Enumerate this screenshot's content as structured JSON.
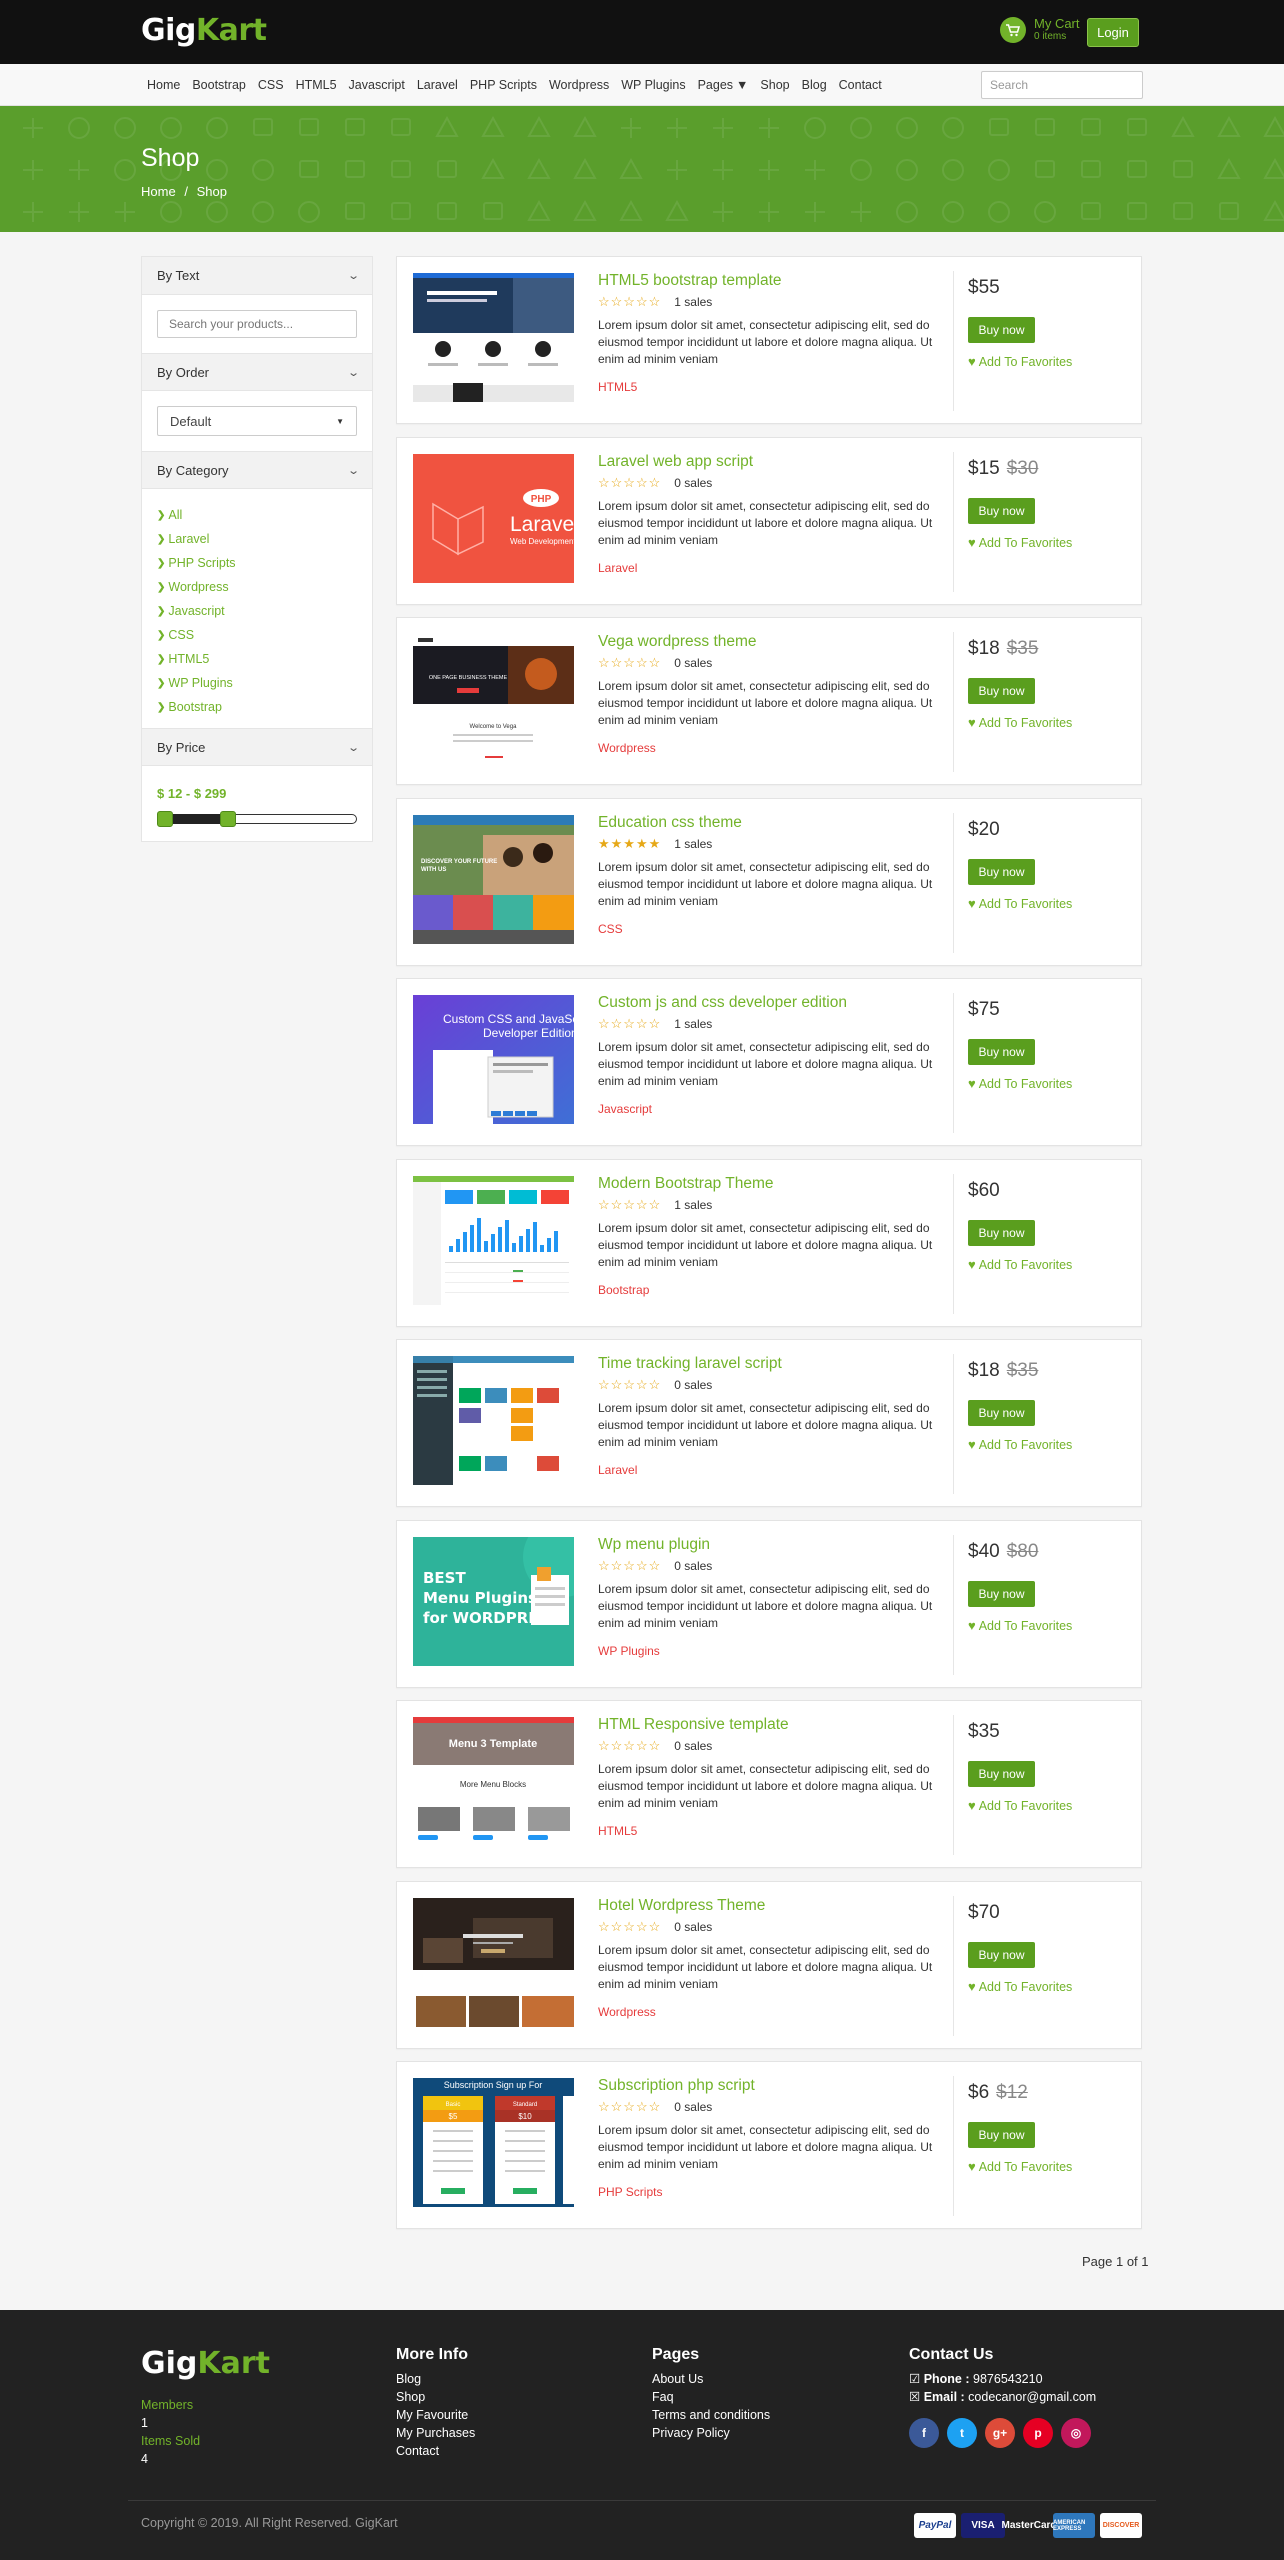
{
  "header": {
    "logo_a": "Gig",
    "logo_b": "Kart",
    "cart_label": "My Cart",
    "cart_count": "0 items",
    "login": "Login"
  },
  "nav": {
    "items": [
      "Home",
      "Bootstrap",
      "CSS",
      "HTML5",
      "Javascript",
      "Laravel",
      "PHP Scripts",
      "Wordpress",
      "WP Plugins",
      "Pages",
      "Shop",
      "Blog",
      "Contact"
    ],
    "search_placeholder": "Search"
  },
  "banner": {
    "title": "Shop",
    "crumb_home": "Home",
    "crumb_sep": "/",
    "crumb_current": "Shop"
  },
  "sidebar": {
    "by_text": "By Text",
    "search_placeholder": "Search your products...",
    "by_order": "By Order",
    "order_value": "Default",
    "by_category": "By Category",
    "categories": [
      "All",
      "Laravel",
      "PHP Scripts",
      "Wordpress",
      "Javascript",
      "CSS",
      "HTML5",
      "WP Plugins",
      "Bootstrap"
    ],
    "by_price": "By Price",
    "price_range": "$ 12 - $ 299",
    "slider_min_fraction": 0.0,
    "slider_max_fraction": 0.18
  },
  "products": [
    {
      "title": "HTML5 bootstrap template",
      "rating": 0,
      "sales": "1 sales",
      "desc": "Lorem ipsum dolor sit amet, consectetur adipiscing elit, sed do eiusmod tempor incididunt ut labore et dolore magna aliqua. Ut enim ad minim veniam",
      "category": "HTML5",
      "price": "$55",
      "old_price": "",
      "thumb": "html5"
    },
    {
      "title": "Laravel web app script",
      "rating": 0,
      "sales": "0 sales",
      "desc": "Lorem ipsum dolor sit amet, consectetur adipiscing elit, sed do eiusmod tempor incididunt ut labore et dolore magna aliqua. Ut enim ad minim veniam",
      "category": "Laravel",
      "price": "$15",
      "old_price": "$30",
      "thumb": "laravel",
      "thumb_text": "Laravel",
      "thumb_sub": "Web Development",
      "thumb_badge": "PHP"
    },
    {
      "title": "Vega wordpress theme",
      "rating": 0,
      "sales": "0 sales",
      "desc": "Lorem ipsum dolor sit amet, consectetur adipiscing elit, sed do eiusmod tempor incididunt ut labore et dolore magna aliqua. Ut enim ad minim veniam",
      "category": "Wordpress",
      "price": "$18",
      "old_price": "$35",
      "thumb": "vega",
      "thumb_text": "ONE PAGE BUSINESS THEME",
      "thumb_sub": "Welcome to Vega"
    },
    {
      "title": "Education css theme",
      "rating": 5,
      "sales": "1 sales",
      "desc": "Lorem ipsum dolor sit amet, consectetur adipiscing elit, sed do eiusmod tempor incididunt ut labore et dolore magna aliqua. Ut enim ad minim veniam",
      "category": "CSS",
      "price": "$20",
      "old_price": "",
      "thumb": "education",
      "thumb_text": "DISCOVER YOUR FUTURE WITH US"
    },
    {
      "title": "Custom js and css developer edition",
      "rating": 0,
      "sales": "1 sales",
      "desc": "Lorem ipsum dolor sit amet, consectetur adipiscing elit, sed do eiusmod tempor incididunt ut labore et dolore magna aliqua. Ut enim ad minim veniam",
      "category": "Javascript",
      "price": "$75",
      "old_price": "",
      "thumb": "customjs",
      "thumb_text": "Custom CSS and JavaSc",
      "thumb_sub": "Developer Edition"
    },
    {
      "title": "Modern Bootstrap Theme",
      "rating": 0,
      "sales": "1 sales",
      "desc": "Lorem ipsum dolor sit amet, consectetur adipiscing elit, sed do eiusmod tempor incididunt ut labore et dolore magna aliqua. Ut enim ad minim veniam",
      "category": "Bootstrap",
      "price": "$60",
      "old_price": "",
      "thumb": "dashboard"
    },
    {
      "title": "Time tracking laravel script",
      "rating": 0,
      "sales": "0 sales",
      "desc": "Lorem ipsum dolor sit amet, consectetur adipiscing elit, sed do eiusmod tempor incididunt ut labore et dolore magna aliqua. Ut enim ad minim veniam",
      "category": "Laravel",
      "price": "$18",
      "old_price": "$35",
      "thumb": "timetrack"
    },
    {
      "title": "Wp menu plugin",
      "rating": 0,
      "sales": "0 sales",
      "desc": "Lorem ipsum dolor sit amet, consectetur adipiscing elit, sed do eiusmod tempor incididunt ut labore et dolore magna aliqua. Ut enim ad minim veniam",
      "category": "WP Plugins",
      "price": "$40",
      "old_price": "$80",
      "thumb": "wpmenu",
      "thumb_text": "BEST",
      "thumb_sub": "Menu Plugins",
      "thumb_sub2": "for WORDPRESS"
    },
    {
      "title": "HTML Responsive template",
      "rating": 0,
      "sales": "0 sales",
      "desc": "Lorem ipsum dolor sit amet, consectetur adipiscing elit, sed do eiusmod tempor incididunt ut labore et dolore magna aliqua. Ut enim ad minim veniam",
      "category": "HTML5",
      "price": "$35",
      "old_price": "",
      "thumb": "menublocks",
      "thumb_text": "Menu 3 Template",
      "thumb_sub": "More Menu Blocks"
    },
    {
      "title": "Hotel Wordpress Theme",
      "rating": 0,
      "sales": "0 sales",
      "desc": "Lorem ipsum dolor sit amet, consectetur adipiscing elit, sed do eiusmod tempor incididunt ut labore et dolore magna aliqua. Ut enim ad minim veniam",
      "category": "Wordpress",
      "price": "$70",
      "old_price": "",
      "thumb": "hotel"
    },
    {
      "title": "Subscription php script",
      "rating": 0,
      "sales": "0 sales",
      "desc": "Lorem ipsum dolor sit amet, consectetur adipiscing elit, sed do eiusmod tempor incididunt ut labore et dolore magna aliqua. Ut enim ad minim veniam",
      "category": "PHP Scripts",
      "price": "$6",
      "old_price": "$12",
      "thumb": "subscription",
      "thumb_text": "Subscription Sign up For",
      "thumb_sub": "Basic",
      "thumb_sub2": "Standard",
      "thumb_p1": "$5",
      "thumb_p2": "$10"
    }
  ],
  "buy_label": "Buy now",
  "fav_label": "Add To Favorites",
  "pagination": "Page 1 of 1",
  "footer": {
    "logo_a": "Gig",
    "logo_b": "Kart",
    "members_label": "Members",
    "members_value": "1",
    "items_label": "Items Sold",
    "items_value": "4",
    "more_info": {
      "title": "More Info",
      "links": [
        "Blog",
        "Shop",
        "My Favourite",
        "My Purchases",
        "Contact"
      ]
    },
    "pages": {
      "title": "Pages",
      "links": [
        "About Us",
        "Faq",
        "Terms and conditions",
        "Privacy Policy"
      ]
    },
    "contact": {
      "title": "Contact Us",
      "phone_label": "Phone :",
      "phone": "9876543210",
      "email_label": "Email :",
      "email": "codecanor@gmail.com"
    },
    "social": [
      {
        "name": "facebook-icon",
        "glyph": "f",
        "color": "#3b5998"
      },
      {
        "name": "twitter-icon",
        "glyph": "t",
        "color": "#1da1f2"
      },
      {
        "name": "google-plus-icon",
        "glyph": "g+",
        "color": "#dd4b39"
      },
      {
        "name": "pinterest-icon",
        "glyph": "p",
        "color": "#e60023"
      },
      {
        "name": "instagram-icon",
        "glyph": "◎",
        "color": "#c2185b"
      }
    ],
    "copyright": "Copyright © 2019. All Right Reserved. GigKart",
    "payments": [
      "PayPal",
      "VISA",
      "MasterCard",
      "AMERICAN EXPRESS",
      "DISCOVER"
    ]
  },
  "colors": {
    "brand": "#72b32a",
    "button": "#5a9e1e",
    "category": "#e53b3b",
    "banner": "#5a9e2c"
  }
}
